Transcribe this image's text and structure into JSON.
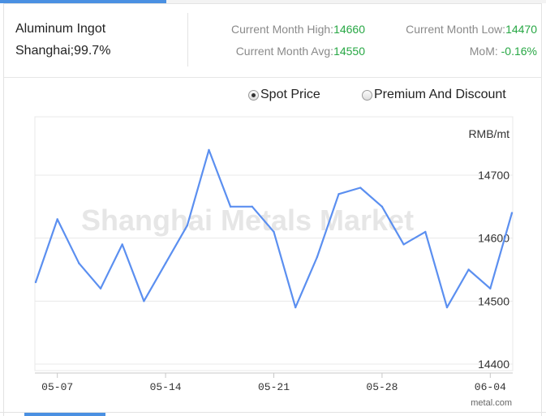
{
  "header": {
    "product_name": "Aluminum Ingot",
    "product_spec": "Shanghai;99.7%",
    "high_label": "Current Month High:",
    "high_value": "14660",
    "low_label": "Current Month Low:",
    "low_value": "14470",
    "avg_label": "Current Month Avg:",
    "avg_value": "14550",
    "mom_label": "MoM:",
    "mom_value": "-0.16%"
  },
  "toggles": {
    "spot_label": "Spot Price",
    "premium_label": "Premium And Discount",
    "selected": "spot"
  },
  "watermark": "Shanghai Metals Market",
  "credit": "metal.com",
  "colors": {
    "line": "#5b8ff0",
    "positive": "#27a744",
    "accent_tab": "#4a90e2"
  },
  "chart_data": {
    "type": "line",
    "ylabel": "RMB/mt",
    "ylim": [
      14400,
      14700
    ],
    "yticks": [
      14700,
      14600,
      14500,
      14400
    ],
    "xticks": [
      "05-07",
      "05-14",
      "05-21",
      "05-28",
      "06-04"
    ],
    "dates": [
      "05-06",
      "05-07",
      "05-08",
      "05-09",
      "05-10",
      "05-13",
      "05-14",
      "05-15",
      "05-16",
      "05-17",
      "05-20",
      "05-21",
      "05-22",
      "05-23",
      "05-24",
      "05-27",
      "05-28",
      "05-29",
      "05-30",
      "05-31",
      "06-03",
      "06-04",
      "06-05"
    ],
    "values": [
      14530,
      14630,
      14560,
      14520,
      14590,
      14500,
      14560,
      14620,
      14740,
      14650,
      14650,
      14610,
      14490,
      14570,
      14670,
      14680,
      14650,
      14590,
      14610,
      14490,
      14550,
      14520,
      14640
    ],
    "grid": true,
    "yaxis_position": "right"
  }
}
